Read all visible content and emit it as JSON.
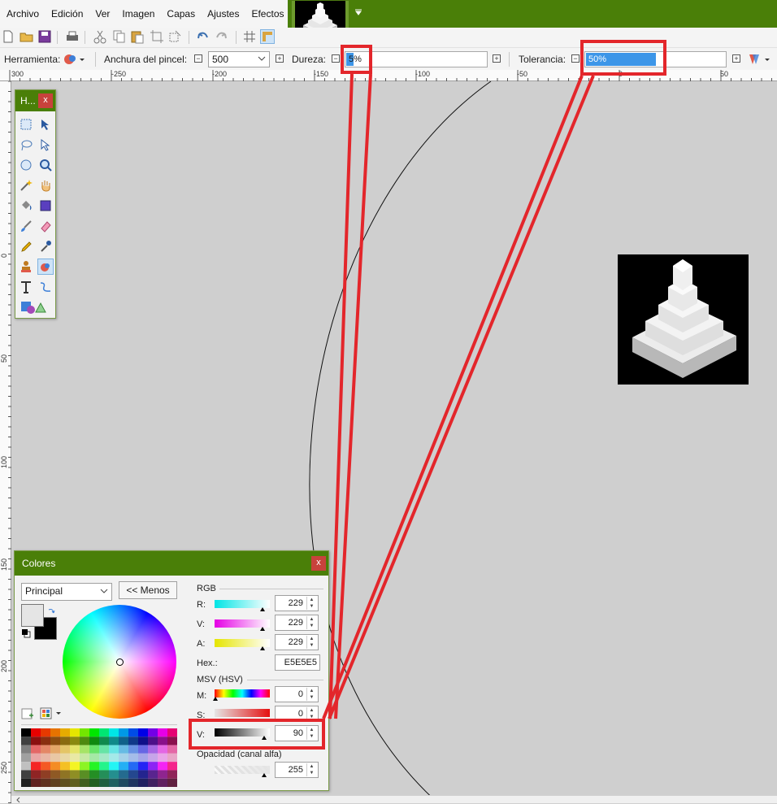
{
  "menu": {
    "items": [
      "Archivo",
      "Edición",
      "Ver",
      "Imagen",
      "Capas",
      "Ajustes",
      "Efectos"
    ]
  },
  "options": {
    "tool_label": "Herramienta:",
    "brush_width_label": "Anchura del pincel:",
    "brush_width_value": "500",
    "hardness_label": "Dureza:",
    "hardness_value": "5%",
    "hardness_fraction": 0.05,
    "tolerance_label": "Tolerancia:",
    "tolerance_value": "50%",
    "tolerance_fraction": 0.5
  },
  "rulers": {
    "h_ticks": [
      "300",
      "-250",
      "-200",
      "-150",
      "-100",
      "-50",
      "0",
      "50"
    ],
    "v_ticks": [
      "0",
      "50",
      "100",
      "150",
      "200",
      "250"
    ]
  },
  "tools_window": {
    "title": "H...",
    "close": "x"
  },
  "colors_window": {
    "title": "Colores",
    "close": "x",
    "mode": "Principal",
    "less_button": "<< Menos",
    "rgb_label": "RGB",
    "r_label": "R:",
    "r_value": "229",
    "g_label": "V:",
    "g_value": "229",
    "b_label": "A:",
    "b_value": "229",
    "hex_label": "Hex.:",
    "hex_value": "E5E5E5",
    "hsv_label": "MSV (HSV)",
    "h_label": "M:",
    "h_value": "0",
    "s_label": "S:",
    "s_value": "0",
    "v_label": "V:",
    "v_value": "90",
    "alpha_label": "Opacidad (canal alfa)",
    "alpha_value": "255",
    "primary_color": "#e5e5e5",
    "secondary_color": "#000000"
  },
  "colors": {
    "accent_green": "#4a7f08",
    "highlight_red": "#e3262b",
    "slider_blue": "#3d96e8"
  }
}
